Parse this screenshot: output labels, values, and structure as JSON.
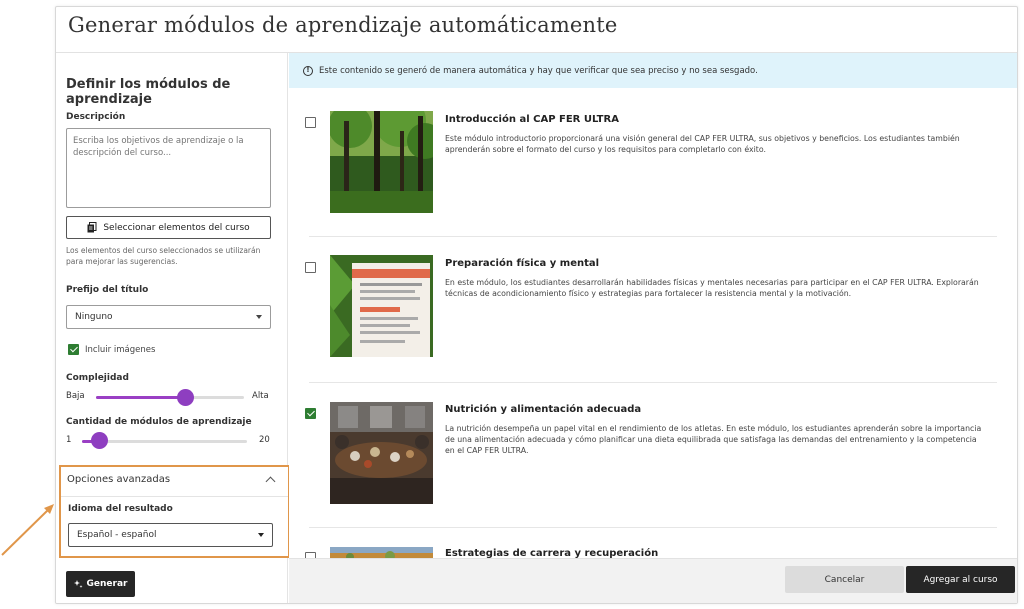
{
  "modal": {
    "title": "Generar módulos de aprendizaje automáticamente"
  },
  "left": {
    "title": "Definir los módulos de aprendizaje",
    "description_label": "Descripción",
    "description_placeholder": "Escriba los objetivos de aprendizaje o la descripción del curso...",
    "select_button": "Seleccionar elementos del curso",
    "help_text": "Los elementos del curso seleccionados se utilizarán para mejorar las sugerencias.",
    "prefix_label": "Prefijo del título",
    "prefix_value": "Ninguno",
    "include_images": "Incluir imágenes",
    "include_images_checked": true,
    "complexity_label": "Complejidad",
    "complexity_min": "Baja",
    "complexity_max": "Alta",
    "complexity_level": 0.6,
    "count_label": "Cantidad de módulos de aprendizaje",
    "count_min": "1",
    "count_max": "20",
    "count_value": 3,
    "advanced_title": "Opciones avanzadas",
    "language_label": "Idioma del resultado",
    "language_value": "Español - español",
    "generate_button": "Generar"
  },
  "banner": {
    "text": "Este contenido se generó de manera automática y hay que verificar que sea preciso y no sea sesgado."
  },
  "modules": [
    {
      "title": "Introducción al CAP FER ULTRA",
      "checked": false,
      "image": "forest",
      "description": "Este módulo introductorio proporcionará una visión general del CAP FER ULTRA, sus objetivos y beneficios. Los estudiantes también aprenderán sobre el formato del curso y los requisitos para completarlo con éxito."
    },
    {
      "title": "Preparación física y mental",
      "checked": false,
      "image": "document-plant",
      "description": "En este módulo, los estudiantes desarrollarán habilidades físicas y mentales necesarias para participar en el CAP FER ULTRA. Explorarán técnicas de acondicionamiento físico y estrategias para fortalecer la resistencia mental y la motivación."
    },
    {
      "title": "Nutrición y alimentación adecuada",
      "checked": true,
      "image": "dinner-table",
      "description": "La nutrición desempeña un papel vital en el rendimiento de los atletas. En este módulo, los estudiantes aprenderán sobre la importancia de una alimentación adecuada y cómo planificar una dieta equilibrada que satisfaga las demandas del entrenamiento y la competencia en el CAP FER ULTRA."
    },
    {
      "title": "Estrategias de carrera y recuperación",
      "checked": false,
      "image": "landscape",
      "description": ""
    }
  ],
  "footer": {
    "cancel": "Cancelar",
    "add": "Agregar al curso"
  },
  "colors": {
    "accent_purple": "#8e3ec0",
    "check_green": "#2e7d32",
    "highlight_orange": "#e0964a",
    "banner_blue": "#dff3fb"
  }
}
